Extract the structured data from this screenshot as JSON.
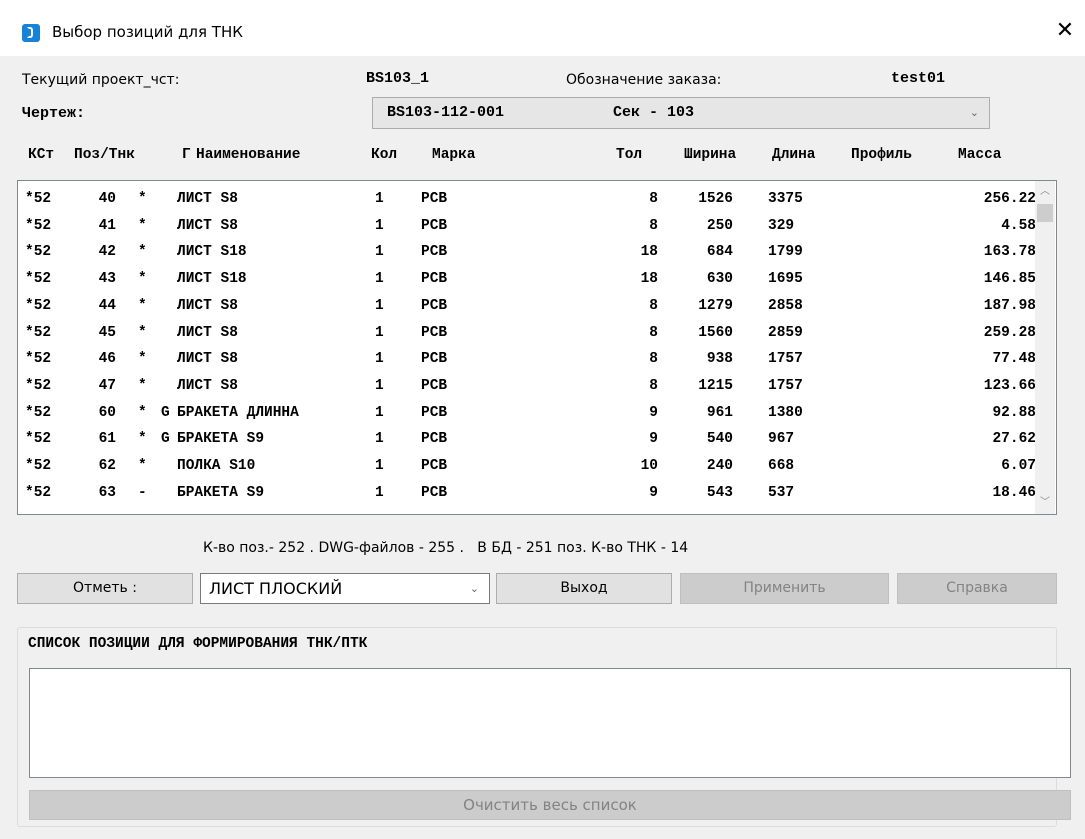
{
  "window": {
    "title": "Выбор позиций для ТНК",
    "close": "✕"
  },
  "project": {
    "label": "Текущий проект_чст:",
    "value": "BS103_1",
    "order_label": "Обозначение заказа:",
    "order_value": "test01"
  },
  "drawing": {
    "label": "Чертеж:",
    "selected_code": "BS103-112-001",
    "selected_section": "Сек - 103",
    "chevron": "⌄"
  },
  "table": {
    "headers": [
      "КСт",
      "Поз/Тнк",
      "Г",
      "Наименование",
      "Кол",
      "Марка",
      "Тол",
      "Ширина",
      "Длина",
      "Профиль",
      "Масса"
    ],
    "rows": [
      [
        "*52",
        "40",
        "*",
        "",
        "ЛИСТ S8",
        "1",
        "РСВ",
        "8",
        "1526",
        "3375",
        "",
        "256.22"
      ],
      [
        "*52",
        "41",
        "*",
        "",
        "ЛИСТ S8",
        "1",
        "РСВ",
        "8",
        "250",
        "329",
        "",
        "4.58"
      ],
      [
        "*52",
        "42",
        "*",
        "",
        "ЛИСТ S18",
        "1",
        "РСВ",
        "18",
        "684",
        "1799",
        "",
        "163.78"
      ],
      [
        "*52",
        "43",
        "*",
        "",
        "ЛИСТ S18",
        "1",
        "РСВ",
        "18",
        "630",
        "1695",
        "",
        "146.85"
      ],
      [
        "*52",
        "44",
        "*",
        "",
        "ЛИСТ S8",
        "1",
        "РСВ",
        "8",
        "1279",
        "2858",
        "",
        "187.98"
      ],
      [
        "*52",
        "45",
        "*",
        "",
        "ЛИСТ S8",
        "1",
        "РСВ",
        "8",
        "1560",
        "2859",
        "",
        "259.28"
      ],
      [
        "*52",
        "46",
        "*",
        "",
        "ЛИСТ S8",
        "1",
        "РСВ",
        "8",
        "938",
        "1757",
        "",
        "77.48"
      ],
      [
        "*52",
        "47",
        "*",
        "",
        "ЛИСТ S8",
        "1",
        "РСВ",
        "8",
        "1215",
        "1757",
        "",
        "123.66"
      ],
      [
        "*52",
        "60",
        "*",
        "G",
        "БРАКЕТА ДЛИННА",
        "1",
        "РСВ",
        "9",
        "961",
        "1380",
        "",
        "92.88"
      ],
      [
        "*52",
        "61",
        "*",
        "G",
        "БРАКЕТА S9",
        "1",
        "РСВ",
        "9",
        "540",
        "967",
        "",
        "27.62"
      ],
      [
        "*52",
        "62",
        "*",
        "",
        "ПОЛКА S10",
        "1",
        "РСВ",
        "10",
        "240",
        "668",
        "",
        "6.07"
      ],
      [
        "*52",
        "63",
        "-",
        "",
        "БРАКЕТА S9",
        "1",
        "РСВ",
        "9",
        "543",
        "537",
        "",
        "18.46"
      ]
    ]
  },
  "status": "К-во поз.- 252 . DWG-файлов - 255 .   В БД - 251 поз. К-во ТНК - 14",
  "toolbar": {
    "mark_label": "Отметь :",
    "filter_value": "ЛИСТ ПЛОСКИЙ",
    "exit_label": "Выход",
    "apply_label": "Применить",
    "help_label": "Справка"
  },
  "list_panel": {
    "title": "СПИСОК ПОЗИЦИИ ДЛЯ ФОРМИРОВАНИЯ ТНК/ПТК",
    "clear_label": "Очистить весь список"
  },
  "icons": {
    "app": "app-icon",
    "close": "close-icon",
    "dropdown": "chevron-down-icon",
    "scroll_up": "scroll-up-icon",
    "scroll_down": "scroll-down-icon"
  },
  "colors": {
    "window_bg": "#f0f0f0",
    "grid_bg": "#ffffff",
    "button_bg": "#e1e1e1",
    "disabled_text": "#838383",
    "app_icon": "#1683d8"
  }
}
